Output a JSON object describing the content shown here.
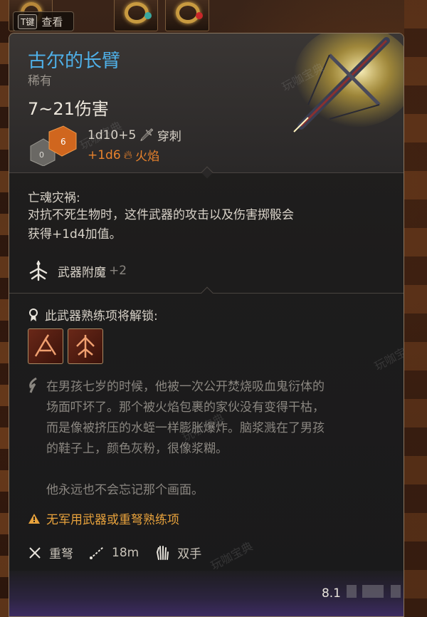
{
  "view_button": {
    "key": "T键",
    "label": "查看"
  },
  "item": {
    "name": "古尔的长臂",
    "rarity": "稀有",
    "damage_range": "7~21伤害",
    "damage_primary": "1d10+5",
    "damage_primary_type": "穿刺",
    "damage_bonus": "+1d6",
    "damage_bonus_type": "火焰"
  },
  "effect": {
    "title": "亡魂灾祸:",
    "line1": "对抗不死生物时，这件武器的攻击以及伤害掷骰会",
    "line2": "获得+1d4加值。"
  },
  "enchant": {
    "label": "武器附魔",
    "value": "+2"
  },
  "proficiency": {
    "label": "此武器熟练项将解锁:"
  },
  "lore": {
    "line1": "在男孩七岁的时候，他被一次公开焚烧吸血鬼衍体的",
    "line2": "场面吓坏了。那个被火焰包裹的家伙没有变得干枯，",
    "line3": "而是像被挤压的水蛭一样膨胀爆炸。脑浆溅在了男孩",
    "line4": "的鞋子上，颜色灰粉，很像浆糊。",
    "line5": "他永远也不会忘记那个画面。"
  },
  "warning": "无军用武器或重弩熟练项",
  "properties": {
    "weapon_type": "重弩",
    "range": "18m",
    "handedness": "双手"
  },
  "weight": "8.1",
  "watermark": "玩咖宝典",
  "colors": {
    "name": "#4fb0e8",
    "fire": "#e8822c",
    "warning": "#e8a23c",
    "lore": "#8a8680"
  }
}
